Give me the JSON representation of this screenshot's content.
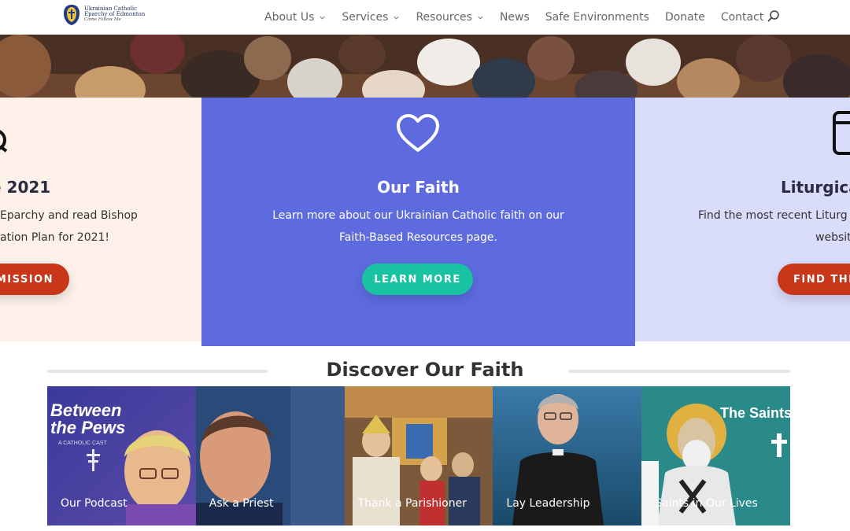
{
  "header": {
    "logo": {
      "line1": "Ukrainian Catholic",
      "line2": "Eparchy of Edmonton",
      "motto": "Come Follow Me"
    },
    "nav": [
      {
        "label": "About Us",
        "has_dropdown": true
      },
      {
        "label": "Services",
        "has_dropdown": true
      },
      {
        "label": "Resources",
        "has_dropdown": true
      },
      {
        "label": "News",
        "has_dropdown": false
      },
      {
        "label": "Safe Environments",
        "has_dropdown": false
      },
      {
        "label": "Donate",
        "has_dropdown": false
      },
      {
        "label": "Contact",
        "has_dropdown": false
      }
    ],
    "search_icon": "search-icon"
  },
  "cards": {
    "left": {
      "title": "e 2021",
      "desc_line1": "Eparchy and read Bishop",
      "desc_line2": "ation Plan for 2021!",
      "button": "MISSION",
      "background": "#fdf1ea",
      "button_color": "#c9361a"
    },
    "middle": {
      "icon": "heart-icon",
      "title": "Our Faith",
      "desc_line1": "Learn more about our Ukrainian Catholic faith on our",
      "desc_line2": "Faith-Based Resources page.",
      "button": "LEARN MORE",
      "background": "#5e6bdf",
      "button_color": "#17c3a0"
    },
    "right": {
      "icon": "calendar-icon",
      "title": "Liturgica",
      "desc_line1": "Find the most recent Liturg",
      "desc_line2": "websit",
      "button": "FIND THE",
      "background": "#d9dcfb",
      "button_color": "#c9361a"
    }
  },
  "discover": {
    "title": "Discover Our Faith",
    "tiles": [
      {
        "label": "Our Podcast",
        "overlay_title_1": "Between",
        "overlay_title_2": "the Pews",
        "overlay_sub": "A CATHOLIC CAST"
      },
      {
        "label": "Ask a Priest"
      },
      {
        "label": "Thank a Parishioner"
      },
      {
        "label": "Lay Leadership"
      },
      {
        "label": "Saints in Our Lives",
        "overlay_title": "The Saints In"
      }
    ]
  }
}
